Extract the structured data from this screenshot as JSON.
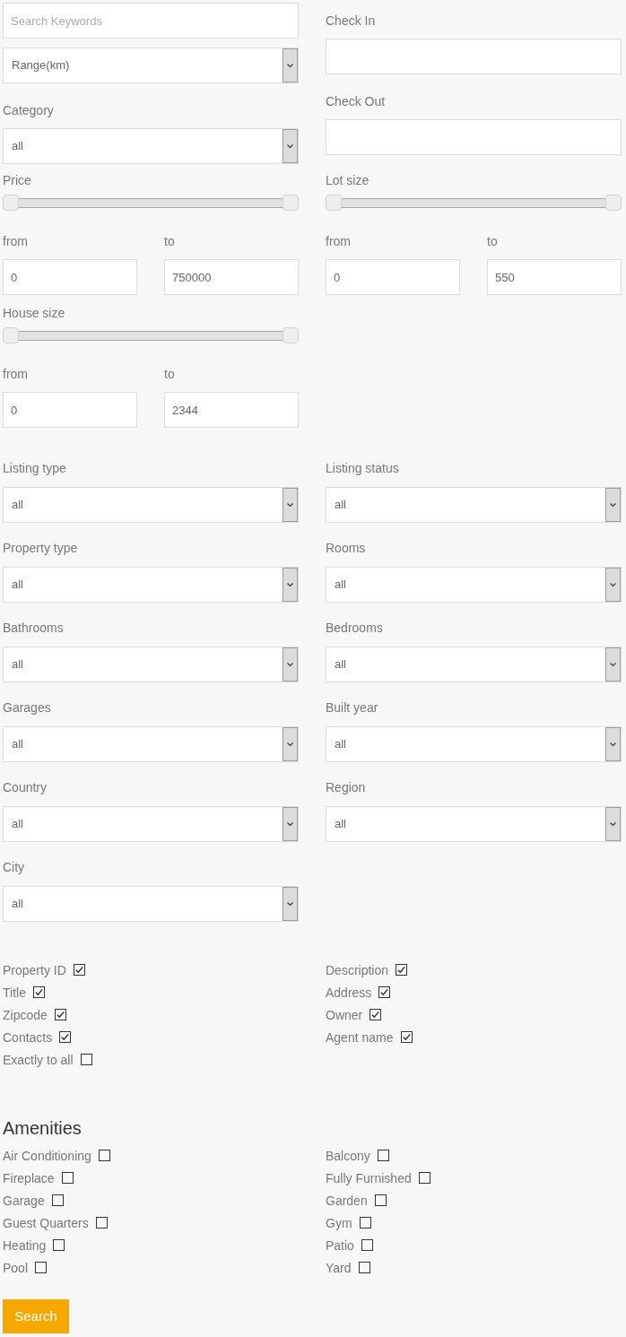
{
  "keyword_search": {
    "placeholder": "Search Keywords"
  },
  "range_select": {
    "value": "Range(km)"
  },
  "category": {
    "label": "Category",
    "value": "all"
  },
  "check_in": {
    "label": "Check In"
  },
  "check_out": {
    "label": "Check Out"
  },
  "range_filters": [
    {
      "label": "Price",
      "handles": [
        {
          "level": 0
        },
        {
          "level": 1
        }
      ],
      "from": {
        "label": "from",
        "value": "0"
      },
      "to": {
        "label": "to",
        "value": "750000"
      }
    },
    {
      "label": "Lot size",
      "handles": [
        {
          "level": 0
        },
        {
          "level": 1
        }
      ],
      "from": {
        "label": "from",
        "value": "0"
      },
      "to": {
        "label": "to",
        "value": "550"
      }
    },
    {
      "label": "House size",
      "handles": [
        {
          "level": 0
        },
        {
          "level": 1
        }
      ],
      "from": {
        "label": "from",
        "value": "0"
      },
      "to": {
        "label": "to",
        "value": "2344"
      }
    }
  ],
  "dropdowns": [
    {
      "label": "Listing type",
      "value": "all"
    },
    {
      "label": "Listing status",
      "value": "all"
    },
    {
      "label": "Property type",
      "value": "all"
    },
    {
      "label": "Rooms",
      "value": "all"
    },
    {
      "label": "Bathrooms",
      "value": "all"
    },
    {
      "label": "Bedrooms",
      "value": "all"
    },
    {
      "label": "Garages",
      "value": "all"
    },
    {
      "label": "Built year",
      "value": "all"
    },
    {
      "label": "Country",
      "value": "all"
    },
    {
      "label": "Region",
      "value": "all"
    },
    {
      "label": "City",
      "value": "all"
    }
  ],
  "search_in": [
    {
      "label": "Property ID",
      "checked": true
    },
    {
      "label": "Description",
      "checked": true
    },
    {
      "label": "Title",
      "checked": true
    },
    {
      "label": "Address",
      "checked": true
    },
    {
      "label": "Zipcode",
      "checked": true
    },
    {
      "label": "Owner",
      "checked": true
    },
    {
      "label": "Contacts",
      "checked": true
    },
    {
      "label": "Agent name",
      "checked": true
    },
    {
      "label": "Exactly to all",
      "checked": false
    }
  ],
  "amenities": {
    "title": "Amenities",
    "items": [
      {
        "label": "Air Conditioning",
        "checked": false
      },
      {
        "label": "Balcony",
        "checked": false
      },
      {
        "label": "Fireplace",
        "checked": false
      },
      {
        "label": "Fully Furnished",
        "checked": false
      },
      {
        "label": "Garage",
        "checked": false
      },
      {
        "label": "Garden",
        "checked": false
      },
      {
        "label": "Guest Quarters",
        "checked": false
      },
      {
        "label": "Gym",
        "checked": false
      },
      {
        "label": "Heating",
        "checked": false
      },
      {
        "label": "Patio",
        "checked": false
      },
      {
        "label": "Pool",
        "checked": false
      },
      {
        "label": "Yard",
        "checked": false
      }
    ]
  },
  "search_button": {
    "label": "Search"
  }
}
